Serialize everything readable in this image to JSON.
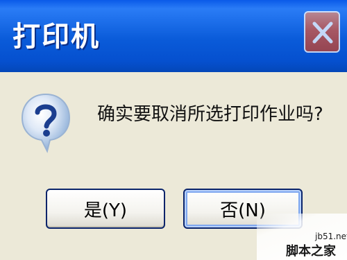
{
  "window": {
    "title": "打印机",
    "close_icon": "close-icon"
  },
  "dialog": {
    "icon": "question-icon",
    "message": "确实要取消所选打印作业吗?",
    "buttons": {
      "yes_label": "是(Y)",
      "no_label": "否(N)"
    }
  },
  "watermark": {
    "line1": "jb51.net",
    "line2": "脚本之家"
  },
  "colors": {
    "titlebar": "#0a5bd9",
    "body": "#ece9d8",
    "close_button": "#d9543a"
  }
}
